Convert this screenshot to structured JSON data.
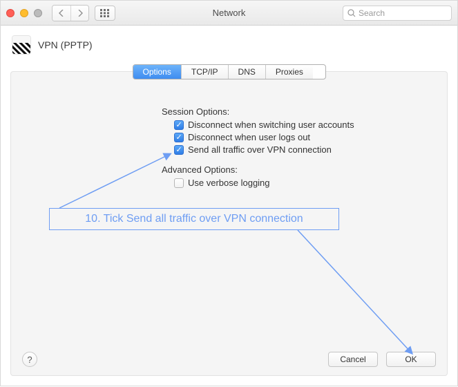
{
  "window": {
    "title": "Network",
    "search_placeholder": "Search"
  },
  "header": {
    "vpn_label": "VPN (PPTP)"
  },
  "tabs": {
    "options": "Options",
    "tcpip": "TCP/IP",
    "dns": "DNS",
    "proxies": "Proxies"
  },
  "session": {
    "title": "Session Options:",
    "opt1": "Disconnect when switching user accounts",
    "opt1_checked": true,
    "opt2": "Disconnect when user logs out",
    "opt2_checked": true,
    "opt3": "Send all traffic over VPN connection",
    "opt3_checked": true
  },
  "advanced": {
    "title": "Advanced Options:",
    "opt1": "Use verbose logging",
    "opt1_checked": false
  },
  "footer": {
    "cancel": "Cancel",
    "ok": "OK"
  },
  "annotation": {
    "text": "10. Tick Send all traffic over VPN connection"
  }
}
